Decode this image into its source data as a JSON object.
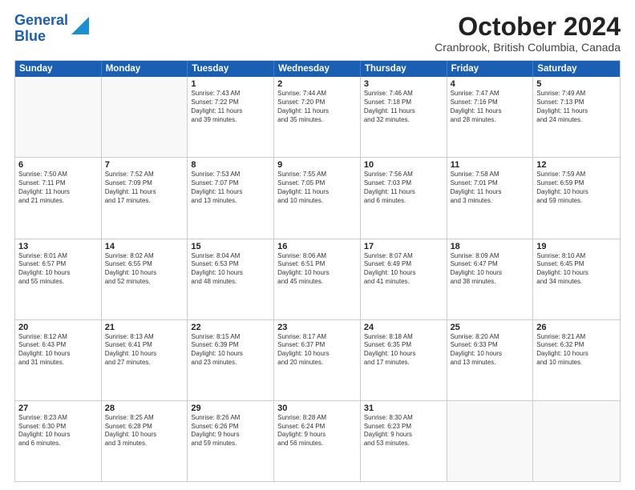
{
  "header": {
    "logo_line1": "General",
    "logo_line2": "Blue",
    "month_title": "October 2024",
    "location": "Cranbrook, British Columbia, Canada"
  },
  "weekdays": [
    "Sunday",
    "Monday",
    "Tuesday",
    "Wednesday",
    "Thursday",
    "Friday",
    "Saturday"
  ],
  "rows": [
    [
      {
        "day": "",
        "empty": true
      },
      {
        "day": "",
        "empty": true
      },
      {
        "day": "1",
        "line1": "Sunrise: 7:43 AM",
        "line2": "Sunset: 7:22 PM",
        "line3": "Daylight: 11 hours",
        "line4": "and 39 minutes."
      },
      {
        "day": "2",
        "line1": "Sunrise: 7:44 AM",
        "line2": "Sunset: 7:20 PM",
        "line3": "Daylight: 11 hours",
        "line4": "and 35 minutes."
      },
      {
        "day": "3",
        "line1": "Sunrise: 7:46 AM",
        "line2": "Sunset: 7:18 PM",
        "line3": "Daylight: 11 hours",
        "line4": "and 32 minutes."
      },
      {
        "day": "4",
        "line1": "Sunrise: 7:47 AM",
        "line2": "Sunset: 7:16 PM",
        "line3": "Daylight: 11 hours",
        "line4": "and 28 minutes."
      },
      {
        "day": "5",
        "line1": "Sunrise: 7:49 AM",
        "line2": "Sunset: 7:13 PM",
        "line3": "Daylight: 11 hours",
        "line4": "and 24 minutes."
      }
    ],
    [
      {
        "day": "6",
        "line1": "Sunrise: 7:50 AM",
        "line2": "Sunset: 7:11 PM",
        "line3": "Daylight: 11 hours",
        "line4": "and 21 minutes."
      },
      {
        "day": "7",
        "line1": "Sunrise: 7:52 AM",
        "line2": "Sunset: 7:09 PM",
        "line3": "Daylight: 11 hours",
        "line4": "and 17 minutes."
      },
      {
        "day": "8",
        "line1": "Sunrise: 7:53 AM",
        "line2": "Sunset: 7:07 PM",
        "line3": "Daylight: 11 hours",
        "line4": "and 13 minutes."
      },
      {
        "day": "9",
        "line1": "Sunrise: 7:55 AM",
        "line2": "Sunset: 7:05 PM",
        "line3": "Daylight: 11 hours",
        "line4": "and 10 minutes."
      },
      {
        "day": "10",
        "line1": "Sunrise: 7:56 AM",
        "line2": "Sunset: 7:03 PM",
        "line3": "Daylight: 11 hours",
        "line4": "and 6 minutes."
      },
      {
        "day": "11",
        "line1": "Sunrise: 7:58 AM",
        "line2": "Sunset: 7:01 PM",
        "line3": "Daylight: 11 hours",
        "line4": "and 3 minutes."
      },
      {
        "day": "12",
        "line1": "Sunrise: 7:59 AM",
        "line2": "Sunset: 6:59 PM",
        "line3": "Daylight: 10 hours",
        "line4": "and 59 minutes."
      }
    ],
    [
      {
        "day": "13",
        "line1": "Sunrise: 8:01 AM",
        "line2": "Sunset: 6:57 PM",
        "line3": "Daylight: 10 hours",
        "line4": "and 55 minutes."
      },
      {
        "day": "14",
        "line1": "Sunrise: 8:02 AM",
        "line2": "Sunset: 6:55 PM",
        "line3": "Daylight: 10 hours",
        "line4": "and 52 minutes."
      },
      {
        "day": "15",
        "line1": "Sunrise: 8:04 AM",
        "line2": "Sunset: 6:53 PM",
        "line3": "Daylight: 10 hours",
        "line4": "and 48 minutes."
      },
      {
        "day": "16",
        "line1": "Sunrise: 8:06 AM",
        "line2": "Sunset: 6:51 PM",
        "line3": "Daylight: 10 hours",
        "line4": "and 45 minutes."
      },
      {
        "day": "17",
        "line1": "Sunrise: 8:07 AM",
        "line2": "Sunset: 6:49 PM",
        "line3": "Daylight: 10 hours",
        "line4": "and 41 minutes."
      },
      {
        "day": "18",
        "line1": "Sunrise: 8:09 AM",
        "line2": "Sunset: 6:47 PM",
        "line3": "Daylight: 10 hours",
        "line4": "and 38 minutes."
      },
      {
        "day": "19",
        "line1": "Sunrise: 8:10 AM",
        "line2": "Sunset: 6:45 PM",
        "line3": "Daylight: 10 hours",
        "line4": "and 34 minutes."
      }
    ],
    [
      {
        "day": "20",
        "line1": "Sunrise: 8:12 AM",
        "line2": "Sunset: 6:43 PM",
        "line3": "Daylight: 10 hours",
        "line4": "and 31 minutes."
      },
      {
        "day": "21",
        "line1": "Sunrise: 8:13 AM",
        "line2": "Sunset: 6:41 PM",
        "line3": "Daylight: 10 hours",
        "line4": "and 27 minutes."
      },
      {
        "day": "22",
        "line1": "Sunrise: 8:15 AM",
        "line2": "Sunset: 6:39 PM",
        "line3": "Daylight: 10 hours",
        "line4": "and 23 minutes."
      },
      {
        "day": "23",
        "line1": "Sunrise: 8:17 AM",
        "line2": "Sunset: 6:37 PM",
        "line3": "Daylight: 10 hours",
        "line4": "and 20 minutes."
      },
      {
        "day": "24",
        "line1": "Sunrise: 8:18 AM",
        "line2": "Sunset: 6:35 PM",
        "line3": "Daylight: 10 hours",
        "line4": "and 17 minutes."
      },
      {
        "day": "25",
        "line1": "Sunrise: 8:20 AM",
        "line2": "Sunset: 6:33 PM",
        "line3": "Daylight: 10 hours",
        "line4": "and 13 minutes."
      },
      {
        "day": "26",
        "line1": "Sunrise: 8:21 AM",
        "line2": "Sunset: 6:32 PM",
        "line3": "Daylight: 10 hours",
        "line4": "and 10 minutes."
      }
    ],
    [
      {
        "day": "27",
        "line1": "Sunrise: 8:23 AM",
        "line2": "Sunset: 6:30 PM",
        "line3": "Daylight: 10 hours",
        "line4": "and 6 minutes."
      },
      {
        "day": "28",
        "line1": "Sunrise: 8:25 AM",
        "line2": "Sunset: 6:28 PM",
        "line3": "Daylight: 10 hours",
        "line4": "and 3 minutes."
      },
      {
        "day": "29",
        "line1": "Sunrise: 8:26 AM",
        "line2": "Sunset: 6:26 PM",
        "line3": "Daylight: 9 hours",
        "line4": "and 59 minutes."
      },
      {
        "day": "30",
        "line1": "Sunrise: 8:28 AM",
        "line2": "Sunset: 6:24 PM",
        "line3": "Daylight: 9 hours",
        "line4": "and 56 minutes."
      },
      {
        "day": "31",
        "line1": "Sunrise: 8:30 AM",
        "line2": "Sunset: 6:23 PM",
        "line3": "Daylight: 9 hours",
        "line4": "and 53 minutes."
      },
      {
        "day": "",
        "empty": true
      },
      {
        "day": "",
        "empty": true
      }
    ]
  ]
}
